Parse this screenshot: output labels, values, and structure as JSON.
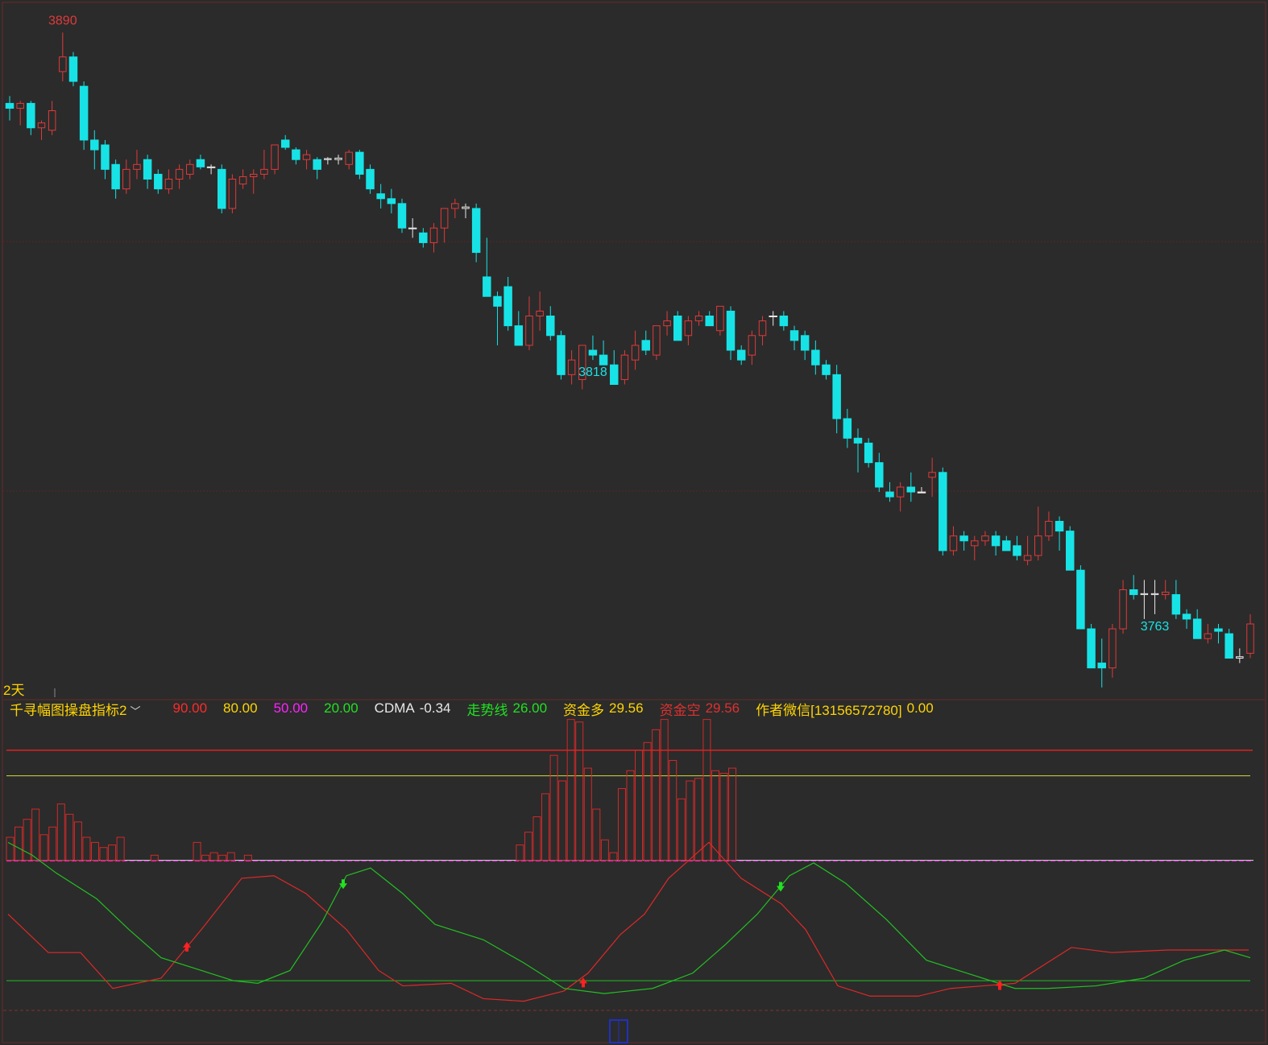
{
  "period_label": "2天",
  "legend": {
    "indicator_name": "千寻幅图操盘指标2",
    "level_90": "90.00",
    "level_80": "80.00",
    "level_50": "50.00",
    "level_20": "20.00",
    "cdma_label": "CDMA",
    "cdma_value": "-0.34",
    "trend_label": "走势线",
    "trend_value": "26.00",
    "fund_long_label": "资金多",
    "fund_long_value": "29.56",
    "fund_short_label": "资金空",
    "fund_short_value": "29.56",
    "author_label": "作者微信[13156572780]",
    "author_value": "0.00"
  },
  "colors": {
    "background": "#2b2b2b",
    "up": "#e03a3a",
    "down": "#17e3e6",
    "doji": "#e8e8e8",
    "grid": "#5a2424",
    "level90": "#e02020",
    "level80": "#d8d838",
    "level50": "#e020e0",
    "level20": "#20c020",
    "red_line": "#e02828",
    "green_line": "#22c022"
  },
  "chart_data": [
    {
      "type": "candlestick",
      "price_ylim": [
        3755,
        3895
      ],
      "annotations": [
        {
          "text": "3890",
          "index": 5,
          "color": "#e03a3a"
        },
        {
          "text": "3818",
          "index": 55,
          "color": "#17e3e6"
        },
        {
          "text": "3763",
          "index": 108,
          "color": "#17e3e6"
        }
      ],
      "ohlc": [
        [
          3875.5,
          3877,
          3872,
          3874.5
        ],
        [
          3874.5,
          3876,
          3871,
          3875.5
        ],
        [
          3875.5,
          3876,
          3869,
          3870.5
        ],
        [
          3870.5,
          3872,
          3868,
          3871.5
        ],
        [
          3870,
          3876,
          3869,
          3874
        ],
        [
          3882,
          3890,
          3880,
          3885
        ],
        [
          3885,
          3886,
          3879,
          3880
        ],
        [
          3879,
          3880,
          3866,
          3868
        ],
        [
          3868,
          3870,
          3862,
          3866
        ],
        [
          3867,
          3868,
          3860,
          3862
        ],
        [
          3863,
          3864,
          3856,
          3858
        ],
        [
          3858,
          3864,
          3857,
          3862
        ],
        [
          3862,
          3866,
          3860,
          3863
        ],
        [
          3864,
          3865,
          3858,
          3860
        ],
        [
          3861,
          3862,
          3857,
          3858
        ],
        [
          3858,
          3862,
          3857,
          3860
        ],
        [
          3860,
          3863,
          3858,
          3862
        ],
        [
          3861,
          3864,
          3860,
          3863
        ],
        [
          3864,
          3865,
          3862,
          3862.5
        ],
        [
          3862.5,
          3863,
          3861,
          3862.5
        ],
        [
          3862,
          3863,
          3853,
          3854
        ],
        [
          3854,
          3861,
          3853,
          3860
        ],
        [
          3859,
          3862,
          3858,
          3860.5
        ],
        [
          3860.5,
          3862,
          3857,
          3861
        ],
        [
          3861,
          3866,
          3860,
          3862
        ],
        [
          3862,
          3867,
          3861,
          3867
        ],
        [
          3868,
          3869,
          3866,
          3866.5
        ],
        [
          3866,
          3866.5,
          3863,
          3864
        ],
        [
          3864,
          3866,
          3862,
          3865
        ],
        [
          3864,
          3864.5,
          3860,
          3862
        ],
        [
          3864,
          3864.5,
          3863,
          3864.2
        ],
        [
          3864,
          3865,
          3863,
          3864.3
        ],
        [
          3863,
          3866,
          3862,
          3865.5
        ],
        [
          3865.5,
          3866,
          3860,
          3861
        ],
        [
          3862,
          3863,
          3857,
          3858
        ],
        [
          3857,
          3859,
          3854,
          3856
        ],
        [
          3856,
          3858,
          3853,
          3855
        ],
        [
          3855,
          3856,
          3849,
          3850
        ],
        [
          3850,
          3852,
          3848,
          3850
        ],
        [
          3849,
          3850,
          3846,
          3847
        ],
        [
          3847,
          3851,
          3845,
          3850
        ],
        [
          3850,
          3854,
          3847,
          3854
        ],
        [
          3854,
          3856,
          3852,
          3855
        ],
        [
          3854,
          3855,
          3852,
          3854.3
        ],
        [
          3854,
          3855,
          3843,
          3845
        ],
        [
          3840,
          3848,
          3838,
          3836
        ],
        [
          3836,
          3837,
          3826,
          3834
        ],
        [
          3838,
          3840,
          3829,
          3830
        ],
        [
          3830,
          3833,
          3827,
          3826
        ],
        [
          3826,
          3836,
          3825,
          3832
        ],
        [
          3832,
          3837,
          3829,
          3833
        ],
        [
          3832,
          3834,
          3827,
          3828
        ],
        [
          3828,
          3829,
          3819,
          3820
        ],
        [
          3820,
          3825,
          3818,
          3823
        ],
        [
          3819,
          3826,
          3817,
          3826
        ],
        [
          3825,
          3828,
          3823,
          3824
        ],
        [
          3824,
          3827,
          3822,
          3822
        ],
        [
          3822,
          3825,
          3818,
          3818
        ],
        [
          3819,
          3825,
          3818,
          3824
        ],
        [
          3823,
          3829,
          3821,
          3826
        ],
        [
          3827,
          3829,
          3824,
          3825
        ],
        [
          3824,
          3830,
          3823,
          3830
        ],
        [
          3830,
          3833,
          3828,
          3831
        ],
        [
          3832,
          3833,
          3827,
          3827
        ],
        [
          3828,
          3832,
          3826,
          3831
        ],
        [
          3831,
          3833,
          3830,
          3832
        ],
        [
          3832,
          3833,
          3830,
          3830
        ],
        [
          3829,
          3834,
          3828,
          3834
        ],
        [
          3833,
          3834,
          3823,
          3825
        ],
        [
          3825,
          3826,
          3822,
          3823
        ],
        [
          3824,
          3829,
          3822,
          3828
        ],
        [
          3828,
          3832,
          3826,
          3831
        ],
        [
          3832,
          3833,
          3830,
          3832
        ],
        [
          3832,
          3833,
          3829,
          3830
        ],
        [
          3829,
          3830,
          3825,
          3827
        ],
        [
          3828,
          3829,
          3823,
          3825
        ],
        [
          3825,
          3827,
          3820,
          3822
        ],
        [
          3822,
          3823,
          3819,
          3820
        ],
        [
          3820,
          3822,
          3808,
          3811
        ],
        [
          3811,
          3813,
          3805,
          3807
        ],
        [
          3807,
          3809,
          3800,
          3806
        ],
        [
          3806,
          3807,
          3801,
          3802
        ],
        [
          3802,
          3804,
          3796,
          3797
        ],
        [
          3796,
          3798,
          3794,
          3795
        ],
        [
          3795,
          3798,
          3792,
          3797
        ],
        [
          3797,
          3800,
          3794,
          3796
        ],
        [
          3796,
          3797,
          3796,
          3795.8
        ],
        [
          3799,
          3803,
          3795,
          3800
        ],
        [
          3800,
          3801,
          3783,
          3784
        ],
        [
          3784,
          3789,
          3783,
          3787
        ],
        [
          3787,
          3788,
          3784,
          3786
        ],
        [
          3785,
          3787,
          3782,
          3786
        ],
        [
          3786,
          3788,
          3785,
          3787
        ],
        [
          3787,
          3788,
          3783,
          3785
        ],
        [
          3786,
          3787,
          3784,
          3784
        ],
        [
          3785,
          3787,
          3782,
          3783
        ],
        [
          3782,
          3787,
          3781,
          3783
        ],
        [
          3783,
          3793,
          3782,
          3787
        ],
        [
          3787,
          3792,
          3786,
          3790
        ],
        [
          3790,
          3791,
          3784,
          3788
        ],
        [
          3788,
          3789,
          3781,
          3780
        ],
        [
          3780,
          3781,
          3768,
          3768
        ],
        [
          3768,
          3769,
          3760,
          3760
        ],
        [
          3761,
          3766,
          3756,
          3760
        ],
        [
          3760,
          3769,
          3758,
          3768
        ],
        [
          3768,
          3778,
          3767,
          3776
        ],
        [
          3776,
          3779,
          3774,
          3775
        ],
        [
          3775,
          3778,
          3770,
          3775.2
        ],
        [
          3775,
          3778,
          3771,
          3775.2
        ],
        [
          3775,
          3778,
          3774,
          3775.5
        ],
        [
          3775,
          3778,
          3770,
          3771
        ],
        [
          3771,
          3772,
          3768,
          3770
        ],
        [
          3770,
          3772,
          3766,
          3766
        ],
        [
          3766,
          3769,
          3765,
          3767
        ],
        [
          3768,
          3769,
          3765,
          3767.5
        ],
        [
          3767,
          3768,
          3762,
          3762
        ],
        [
          3762,
          3764,
          3761,
          3762.3
        ],
        [
          3763,
          3771,
          3762,
          3769
        ]
      ]
    },
    {
      "type": "bar",
      "name": "资金多",
      "ylim": [
        -10,
        100
      ],
      "levels": [
        90,
        80,
        50,
        20
      ],
      "values": [
        9,
        13,
        16,
        20,
        10,
        13,
        22,
        18,
        15,
        9,
        7,
        5,
        6,
        9,
        1,
        1,
        1,
        2,
        1,
        1,
        1,
        1,
        7,
        2,
        3,
        2,
        3,
        1,
        2,
        1,
        1,
        1,
        1,
        1,
        1,
        1,
        1,
        1,
        1,
        1,
        1,
        1,
        1,
        1,
        1,
        1,
        1,
        1,
        1,
        1,
        1,
        1,
        1,
        1,
        1,
        1,
        1,
        1,
        1,
        1,
        6,
        11,
        17,
        26,
        41,
        31,
        55,
        54,
        36,
        20,
        8,
        3,
        28,
        35,
        43,
        46,
        51,
        55,
        39,
        24,
        31,
        32,
        55,
        35,
        34,
        36,
        1,
        1,
        1,
        1,
        1,
        1,
        1,
        1,
        1,
        1,
        1,
        1,
        1,
        1,
        1,
        1,
        1,
        1,
        1,
        1,
        1,
        1,
        1,
        1,
        1,
        1,
        1,
        1,
        1,
        1,
        1,
        1,
        1,
        1,
        1,
        1,
        1,
        1,
        1,
        1,
        1,
        1,
        1,
        1,
        1,
        1,
        1,
        1,
        1,
        1,
        1,
        1,
        1,
        1,
        1,
        1,
        1,
        1,
        1,
        1,
        1
      ]
    }
  ]
}
